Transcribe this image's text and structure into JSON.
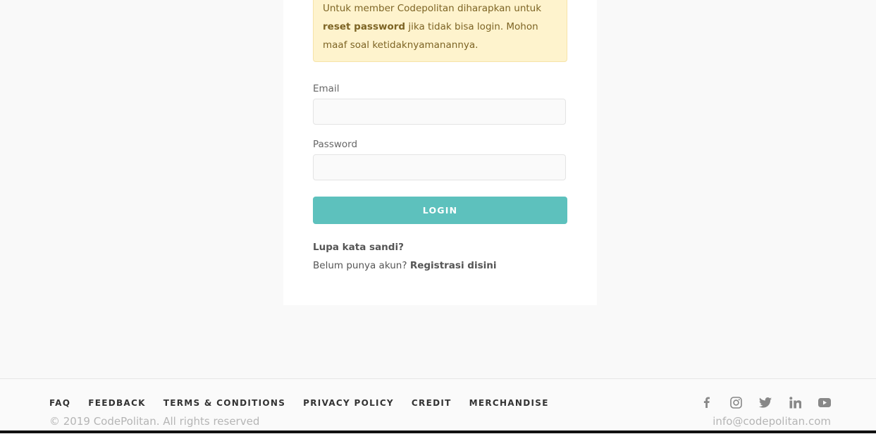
{
  "notice": {
    "line_before": "Untuk member Codepolitan diharapkan untuk ",
    "bold": "reset password",
    "line_after": " jika tidak bisa login. Mohon maaf soal ketidaknyamanannya."
  },
  "form": {
    "email_label": "Email",
    "email_value": "",
    "password_label": "Password",
    "password_value": "",
    "login_button": "LOGIN",
    "forgot_link": "Lupa kata sandi?",
    "register_prompt": "Belum punya akun?",
    "register_link": "Registrasi disini"
  },
  "footer": {
    "nav": [
      "FAQ",
      "FEEDBACK",
      "TERMS & CONDITIONS",
      "PRIVACY POLICY",
      "CREDIT",
      "MERCHANDISE"
    ],
    "copyright": "© 2019 CodePolitan. All rights reserved",
    "email": "info@codepolitan.com",
    "socials": [
      "facebook-icon",
      "instagram-icon",
      "twitter-icon",
      "linkedin-icon",
      "youtube-icon"
    ]
  },
  "colors": {
    "accent": "#5dc1bd",
    "notice_bg": "#fef3cd",
    "notice_text": "#7d6424"
  }
}
